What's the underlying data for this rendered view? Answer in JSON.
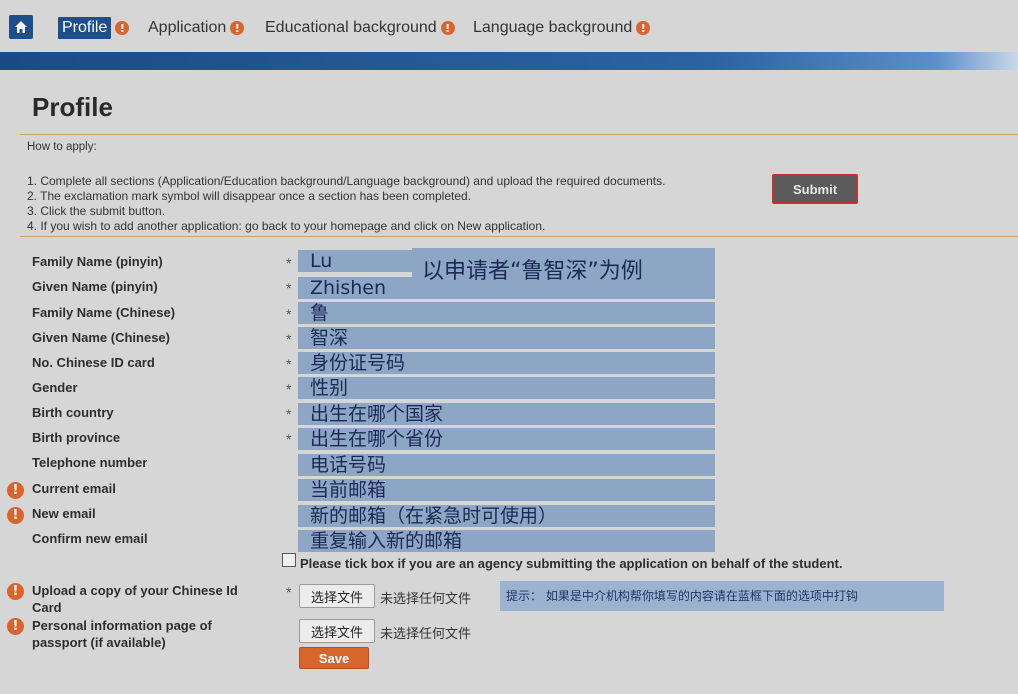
{
  "nav": {
    "items": [
      {
        "label": "Profile",
        "active": true
      },
      {
        "label": "Application",
        "active": false
      },
      {
        "label": "Educational background",
        "active": false
      },
      {
        "label": "Language background",
        "active": false
      }
    ],
    "warn_symbol": "!"
  },
  "page": {
    "title": "Profile",
    "how_to_apply": "How to apply:",
    "steps": [
      "1. Complete all sections (Application/Education background/Language background) and upload the required documents.",
      "2. The exclamation mark symbol will disappear once a section has been completed.",
      "3. Click the submit button.",
      "4. If you wish to add another application: go back to your homepage and click on New application."
    ],
    "submit_label": "Submit"
  },
  "form": {
    "required_mark": "*",
    "fields": [
      {
        "label": "Family Name (pinyin)",
        "value": "Lu",
        "required": true,
        "warn": false
      },
      {
        "label": "Given Name (pinyin)",
        "value": "Zhishen",
        "required": true,
        "warn": false
      },
      {
        "label": "Family Name (Chinese)",
        "value": "鲁",
        "required": true,
        "warn": false
      },
      {
        "label": "Given Name (Chinese)",
        "value": "智深",
        "required": true,
        "warn": false
      },
      {
        "label": "No. Chinese ID card",
        "value": "身份证号码",
        "required": true,
        "warn": false
      },
      {
        "label": "Gender",
        "value": " 性别",
        "required": true,
        "warn": false
      },
      {
        "label": "Birth country",
        "value": "出生在哪个国家",
        "required": true,
        "warn": false
      },
      {
        "label": "Birth province",
        "value": "出生在哪个省份",
        "required": true,
        "warn": false
      },
      {
        "label": "Telephone number",
        "value": "电话号码",
        "required": false,
        "warn": false
      },
      {
        "label": "Current email",
        "value": "当前邮箱",
        "required": false,
        "warn": true
      },
      {
        "label": "New email",
        "value": "新的邮箱（在紧急时可使用）",
        "required": false,
        "warn": true
      },
      {
        "label": "Confirm new email",
        "value": "重复输入新的邮箱",
        "required": false,
        "warn": false
      }
    ],
    "example_note": "以申请者“鲁智深”为例",
    "agency_checkbox_label": "Please tick box if you are an agency submitting the application on behalf of the student.",
    "uploads": [
      {
        "label_line1": "Upload a copy of your Chinese Id",
        "label_line2": "Card",
        "button": "选择文件",
        "status": "未选择任何文件",
        "required": true
      },
      {
        "label_line1": "Personal information page of",
        "label_line2": "passport (if available)",
        "button": "选择文件",
        "status": "未选择任何文件",
        "required": false
      }
    ],
    "hint": "提示：  如果是中介机构帮你填写的内容请在蓝框下面的选项中打钩",
    "save_label": "Save"
  },
  "colors": {
    "brand_blue": "#1f4e8c",
    "warn_orange": "#d9652e",
    "highlight_blue": "#8ea6c6"
  }
}
